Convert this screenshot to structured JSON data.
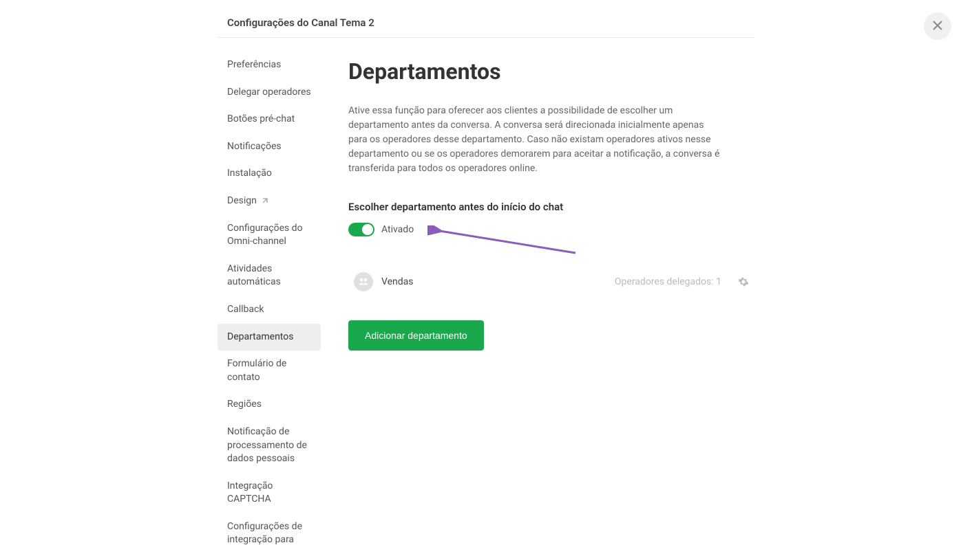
{
  "header": {
    "breadcrumb": "Configurações do Canal Tema 2"
  },
  "sidebar": {
    "items": [
      {
        "label": "Preferências",
        "active": false
      },
      {
        "label": "Delegar operadores",
        "active": false
      },
      {
        "label": "Botões pré-chat",
        "active": false
      },
      {
        "label": "Notificações",
        "active": false
      },
      {
        "label": "Instalação",
        "active": false
      },
      {
        "label": "Design",
        "active": false,
        "external": true
      },
      {
        "label": "Configurações do Omni-channel",
        "active": false
      },
      {
        "label": "Atividades automáticas",
        "active": false
      },
      {
        "label": "Callback",
        "active": false
      },
      {
        "label": "Departamentos",
        "active": true
      },
      {
        "label": "Formulário de contato",
        "active": false
      },
      {
        "label": "Regiões",
        "active": false
      },
      {
        "label": "Notificação de processamento de dados pessoais",
        "active": false
      },
      {
        "label": "Integração CAPTCHA",
        "active": false
      },
      {
        "label": "Configurações de integração para",
        "active": false
      }
    ]
  },
  "main": {
    "title": "Departamentos",
    "description": "Ative essa função para oferecer aos clientes a possibilidade de escolher um departamento antes da conversa. A conversa será direcionada inicialmente apenas para os operadores desse departamento. Caso não existam operadores ativos nesse departamento ou se os operadores demorarem para aceitar a notificação, a conversa é transferida para todos os operadores online.",
    "section_title": "Escolher departamento antes do início do chat",
    "toggle_label": "Ativado",
    "departments": [
      {
        "name": "Vendas",
        "operators_text": "Operadores delegados: 1"
      }
    ],
    "add_button": "Adicionar departamento"
  }
}
